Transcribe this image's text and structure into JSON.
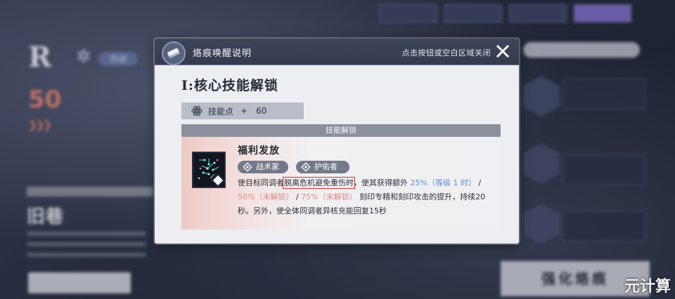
{
  "background": {
    "rank": "R",
    "tag": "作战",
    "level": "50",
    "name": "旧巷",
    "strengthen_label": "强化烙痕",
    "watermark": "元计算"
  },
  "dialog": {
    "title": "烙痕唤醒说明",
    "close_hint": "点击按钮或空白区域关闭",
    "section_heading": "I:核心技能解锁",
    "skill_points": {
      "label": "技能点",
      "plus": "+",
      "value": "60"
    },
    "unlock_bar_label": "技能解锁",
    "skill": {
      "name": "福利发放",
      "tags": [
        "战术家",
        "护佑者"
      ],
      "description": {
        "part1": "使目标同调者",
        "highlighted": "脱离危机避免重伤时",
        "part2": "，使其获得额外 ",
        "value1": "25%（等级 1 时）",
        "sep1": " / ",
        "value2": "50%（未解锁）",
        "sep2": " / ",
        "value3": "75%（未解锁）",
        "part3": " 刻印专精和刻印攻击的提升，持续20秒。另外，使全体同调者异核充能回复15秒"
      }
    }
  },
  "colors": {
    "header_bg": "#3a4155",
    "accent_blue": "#5b8fd6",
    "locked_red": "#e08a83",
    "highlight_box": "#d6302a"
  }
}
